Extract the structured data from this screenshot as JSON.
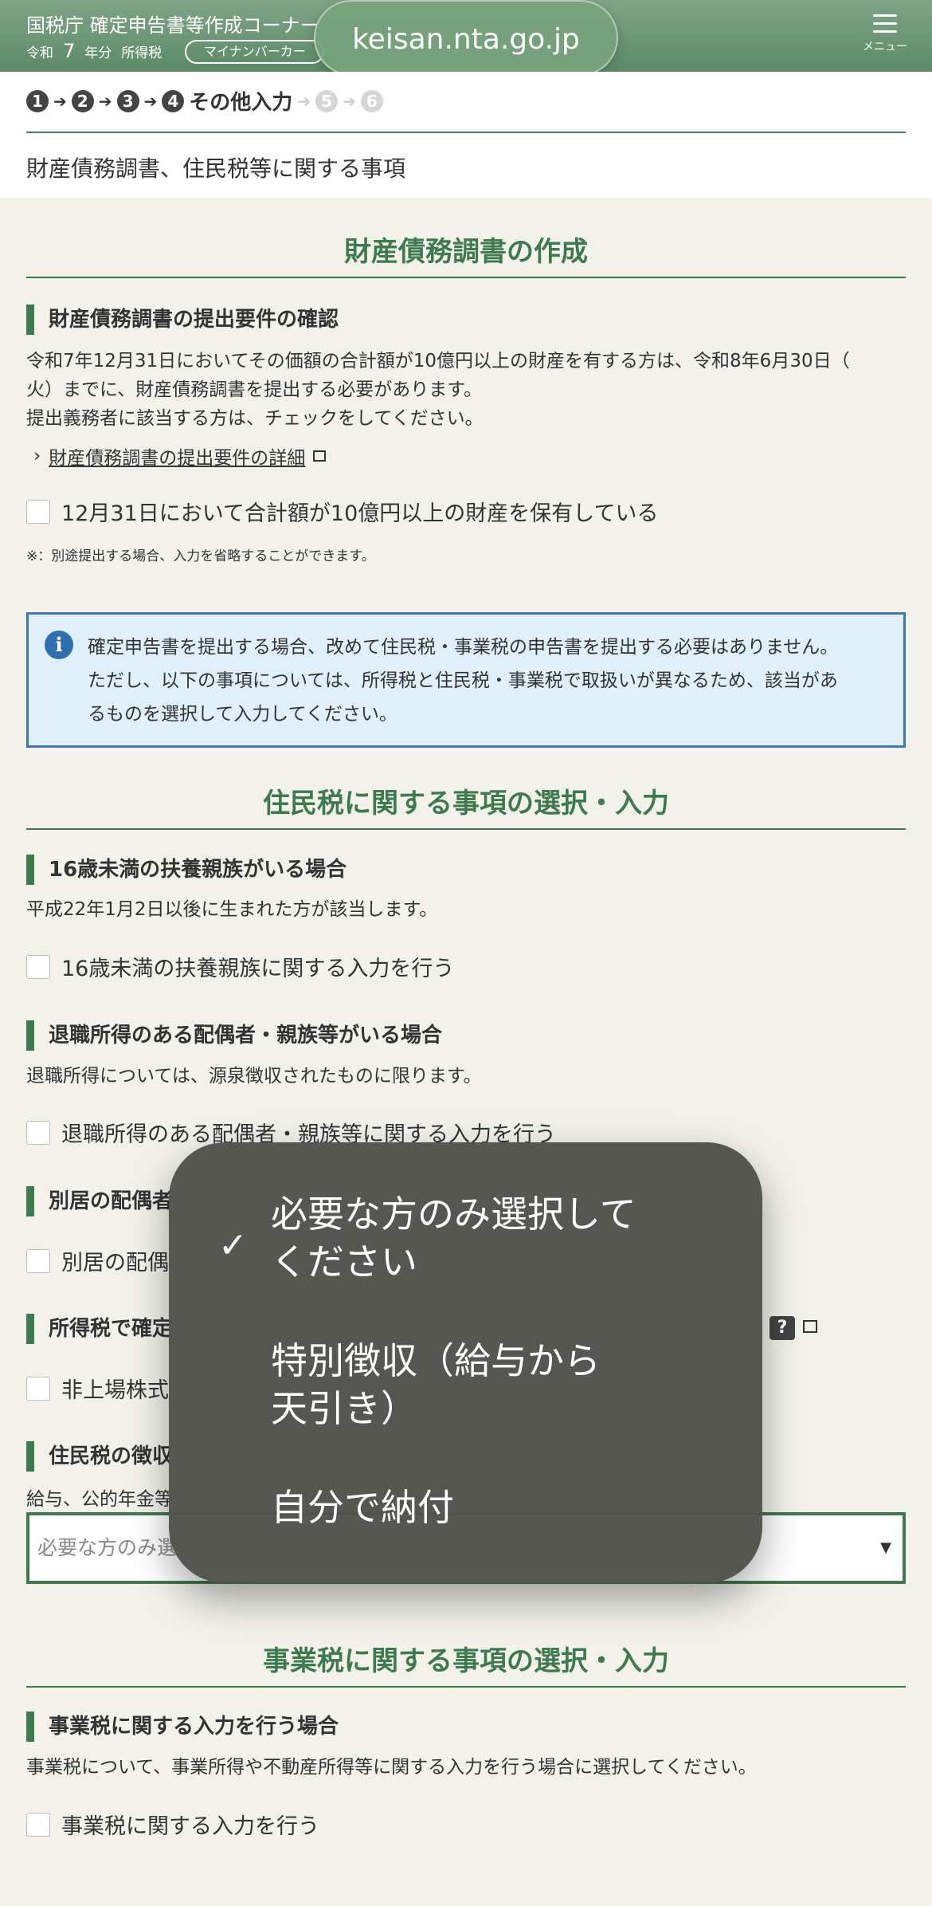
{
  "header": {
    "title": "国税庁 確定申告書等作成コーナー",
    "reiwa": "令和",
    "year": "7",
    "year_suffix": "年分",
    "tax_type": "所得税",
    "mynaportal_label": "マイナンバーカー",
    "url": "keisan.nta.go.jp",
    "menu_label": "メニュー"
  },
  "steps": {
    "items": [
      "1",
      "2",
      "3",
      "4",
      "5",
      "6"
    ],
    "current_label": "その他入力"
  },
  "page_title": "財産債務調書、住民税等に関する事項",
  "asset_section": {
    "heading": "財産債務調書の作成",
    "subheading": "財産債務調書の提出要件の確認",
    "text1": "令和7年12月31日においてその価額の合計額が10億円以上の財産を有する方は、令和8年6月30日（",
    "text2": "火）までに、財産債務調書を提出する必要があります。",
    "text3": "提出義務者に該当する方は、チェックをしてください。",
    "link_label": "財産債務調書の提出要件の詳細",
    "checkbox_label": "12月31日において合計額が10億円以上の財産を保有している",
    "note": "※：別途提出する場合、入力を省略することができます。"
  },
  "info": {
    "line1": "確定申告書を提出する場合、改めて住民税・事業税の申告書を提出する必要はありません。",
    "line2": "ただし、以下の事項については、所得税と住民税・事業税で取扱いが異なるため、該当があ",
    "line3": "るものを選択して入力してください。"
  },
  "resident_section": {
    "heading": "住民税に関する事項の選択・入力",
    "dependents_head": "16歳未満の扶養親族がいる場合",
    "dependents_text": "平成22年1月2日以後に生まれた方が該当します。",
    "dependents_check": "16歳未満の扶養親族に関する入力を行う",
    "retire_head": "退職所得のある配偶者・親族等がいる場合",
    "retire_text": "退職所得については、源泉徴収されたものに限ります。",
    "retire_check": "退職所得のある配偶者・親族等に関する入力を行う",
    "separate_head": "別居の配偶者",
    "separate_check": "別居の配偶",
    "income_head": "所得税で確定",
    "stock_check": "非上場株式",
    "collection_head": "住民税の徴収",
    "collection_text": "給与、公的年金等",
    "select_value": "必要な方のみ選"
  },
  "business_section": {
    "heading": "事業税に関する事項の選択・入力",
    "subheading": "事業税に関する入力を行う場合",
    "text": "事業税について、事業所得や不動産所得等に関する入力を行う場合に選択してください。",
    "check": "事業税に関する入力を行う"
  },
  "dropdown": {
    "options": [
      {
        "line1": "必要な方のみ選択して",
        "line2": "ください",
        "selected": true
      },
      {
        "line1": "特別徴収（給与から",
        "line2": "天引き）",
        "selected": false
      },
      {
        "line1": "自分で納付",
        "line2": "",
        "selected": false
      }
    ]
  }
}
